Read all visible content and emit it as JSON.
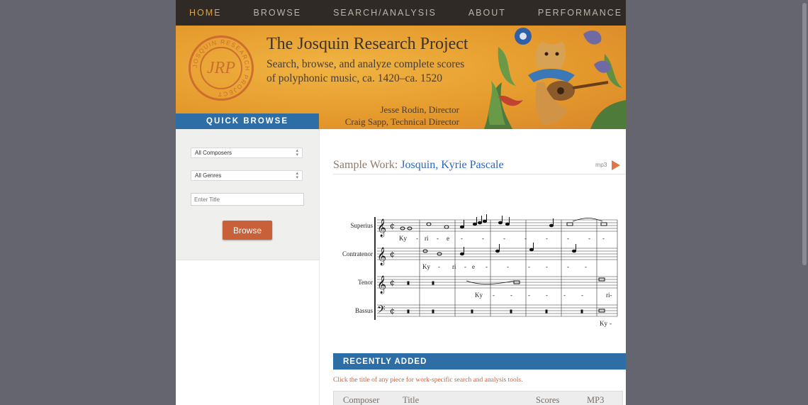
{
  "nav": {
    "items": [
      "HOME",
      "BROWSE",
      "SEARCH/ANALYSIS",
      "ABOUT",
      "PERFORMANCE"
    ],
    "active": "HOME"
  },
  "banner": {
    "title": "The Josquin Research Project",
    "subtitle_line1": "Search, browse, and analyze complete scores",
    "subtitle_line2": "of polyphonic music, ca. 1420–ca. 1520",
    "credit_line1": "Jesse Rodin, Director",
    "credit_line2": "Craig Sapp, Technical Director",
    "seal_initials": "JRP",
    "seal_ring_text": "JOSQUIN RESEARCH PROJECT"
  },
  "quick_browse": {
    "header": "QUICK BROWSE",
    "composer_select": "All Composers",
    "genre_select": "All Genres",
    "title_placeholder": "Enter Title",
    "button_label": "Browse"
  },
  "sample_work": {
    "prefix": "Sample Work:",
    "work_title": "Josquin, Kyrie Pascale",
    "audio_label": "mp3"
  },
  "score": {
    "voices": [
      "Superius",
      "Contratenor",
      "Tenor",
      "Bassus"
    ],
    "lyrics": {
      "superius": [
        "Ky",
        "-",
        "ri",
        "-",
        "e",
        "-",
        "-",
        "-",
        "-",
        "-",
        "-",
        "-",
        "-",
        "-"
      ],
      "contratenor": [
        "Ky",
        "-",
        "ri",
        "-",
        "e",
        "-",
        "-",
        "-",
        "-",
        "-",
        "-",
        "-"
      ],
      "tenor": [
        "Ky",
        "-",
        "-",
        "-",
        "-",
        "-",
        "-",
        "-",
        "ri-"
      ],
      "bassus": [
        "Ky",
        "-"
      ]
    }
  },
  "recently_added": {
    "header": "RECENTLY ADDED",
    "note": "Click the title of any piece for work-specific search and analysis tools.",
    "columns": [
      "Composer",
      "Title",
      "Scores",
      "MP3"
    ]
  },
  "colors": {
    "nav_bg": "#2f2a26",
    "nav_active": "#e0a43b",
    "accent_blue": "#2e6ea6",
    "accent_orange": "#c8603a",
    "link_blue": "#2a66c2"
  }
}
